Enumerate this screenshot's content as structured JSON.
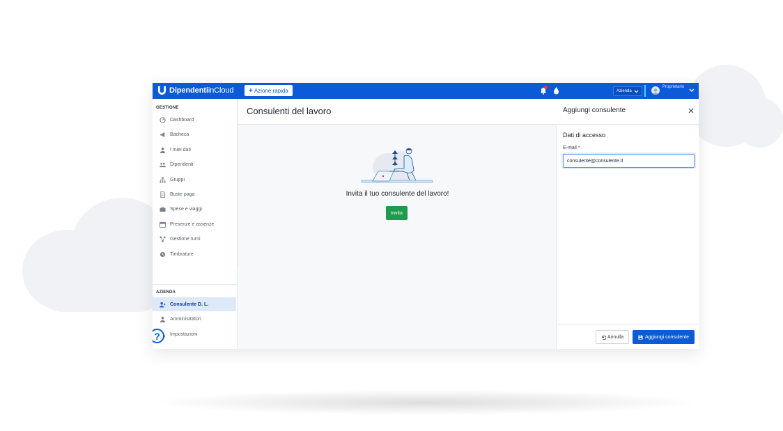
{
  "topbar": {
    "brand_bold": "Dipendenti",
    "brand_light": "inCloud",
    "quick_action_label": "Azione rapida",
    "company_selector": "Azienda",
    "role_label": "Proprietario"
  },
  "sidebar": {
    "section_management": "GESTIONE",
    "items": [
      {
        "label": "Dashboard",
        "icon": "dashboard-icon"
      },
      {
        "label": "Bacheca",
        "icon": "megaphone-icon"
      },
      {
        "label": "I miei dati",
        "icon": "user-icon"
      },
      {
        "label": "Dipendenti",
        "icon": "users-icon"
      },
      {
        "label": "Gruppi",
        "icon": "sitemap-icon"
      },
      {
        "label": "Buste paga",
        "icon": "document-icon"
      },
      {
        "label": "Spese e viaggi",
        "icon": "briefcase-icon"
      },
      {
        "label": "Presenze e assenze",
        "icon": "calendar-icon"
      },
      {
        "label": "Gestione turni",
        "icon": "shifts-icon"
      },
      {
        "label": "Timbrature",
        "icon": "clock-icon"
      }
    ],
    "section_company": "AZIENDA",
    "company_items": [
      {
        "label": "Consulente D. L.",
        "icon": "user-plus-icon",
        "active": true
      },
      {
        "label": "Amministratori",
        "icon": "admin-icon",
        "active": false
      },
      {
        "label": "Impostazioni",
        "icon": "gears-icon",
        "active": false
      }
    ],
    "help_label": "?"
  },
  "main": {
    "title": "Consulenti del lavoro",
    "empty_message": "Invita il tuo consulente del lavoro!",
    "invite_label": "Invita"
  },
  "panel": {
    "title": "Aggiungi consulente",
    "section_title": "Dati di accesso",
    "email_label": "E-mail",
    "required_mark": "*",
    "email_value": "consulente@consulente.it",
    "cancel_label": "Annulla",
    "submit_label": "Aggiungi consulente"
  },
  "colors": {
    "brand_blue": "#0b5bd8",
    "invite_green": "#1e9b4e",
    "active_bg": "#dde8f8",
    "notification_red": "#e53935"
  }
}
